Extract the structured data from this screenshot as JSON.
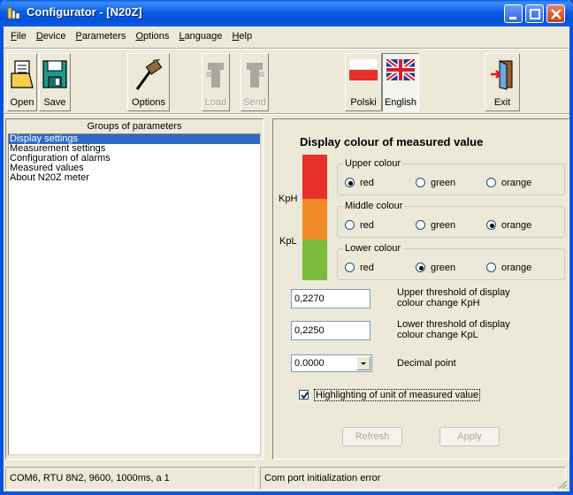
{
  "window": {
    "title": "Configurator - [N20Z]"
  },
  "menu": [
    {
      "label": "File",
      "underline": "F",
      "rest": "ile"
    },
    {
      "label": "Device",
      "underline": "D",
      "rest": "evice"
    },
    {
      "label": "Parameters",
      "underline": "P",
      "rest": "arameters"
    },
    {
      "label": "Options",
      "underline": "O",
      "rest": "ptions"
    },
    {
      "label": "Language",
      "underline": "L",
      "rest": "anguage"
    },
    {
      "label": "Help",
      "underline": "H",
      "rest": "elp"
    }
  ],
  "toolbar": {
    "open_label": "Open",
    "save_label": "Save",
    "options_label": "Options",
    "load_label": "Load",
    "send_label": "Send",
    "polski_label": "Polski",
    "english_label": "English",
    "exit_label": "Exit"
  },
  "groups": {
    "title": "Groups of parameters",
    "items": [
      "Display settings",
      "Measurement settings",
      "Configuration of alarms",
      "Measured values",
      "About N20Z meter"
    ],
    "selected_index": 0
  },
  "display": {
    "title": "Display colour of measured value",
    "kph_label": "KpH",
    "kpl_label": "KpL",
    "colors": {
      "red": "#e8302a",
      "orange": "#f28c28",
      "green": "#7cbb3c"
    },
    "upper": {
      "legend": "Upper colour",
      "options": [
        "red",
        "green",
        "orange"
      ],
      "selected": "red"
    },
    "middle": {
      "legend": "Middle colour",
      "options": [
        "red",
        "green",
        "orange"
      ],
      "selected": "orange"
    },
    "lower": {
      "legend": "Lower colour",
      "options": [
        "red",
        "green",
        "orange"
      ],
      "selected": "green"
    },
    "upper_threshold": {
      "value": "0,2270",
      "label_line1": "Upper threshold of display",
      "label_line2": "colour change KpH"
    },
    "lower_threshold": {
      "value": "0,2250",
      "label_line1": "Lower threshold of display",
      "label_line2": "colour change KpL"
    },
    "decimal_point": {
      "value": "0.0000",
      "label": "Decimal point"
    },
    "highlighting": {
      "checked": true,
      "label": "Highlighting of unit of measured value"
    },
    "refresh_label": "Refresh",
    "apply_label": "Apply"
  },
  "status": {
    "connection": "COM6, RTU 8N2, 9600, 1000ms, a 1",
    "message": "Com port initialization error"
  }
}
